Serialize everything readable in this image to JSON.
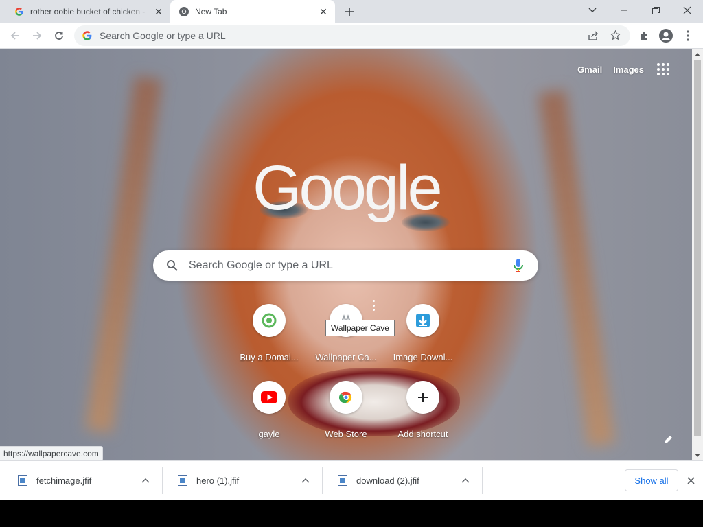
{
  "tabs": [
    {
      "title": "rother oobie bucket of chicken -",
      "active": false
    },
    {
      "title": "New Tab",
      "active": true
    }
  ],
  "omnibox": {
    "placeholder": "Search Google or type a URL"
  },
  "ntp": {
    "top_links": {
      "gmail": "Gmail",
      "images": "Images"
    },
    "logo": "Google",
    "search_placeholder": "Search Google or type a URL",
    "shortcuts": [
      {
        "label": "Buy a Domai...",
        "icon": "green-ring-icon"
      },
      {
        "label": "Wallpaper Ca...",
        "icon": "wallpaper-cave-icon"
      },
      {
        "label": "Image Downl...",
        "icon": "download-arrow-icon"
      },
      {
        "label": "gayle",
        "icon": "youtube-icon"
      },
      {
        "label": "Web Store",
        "icon": "chrome-icon"
      },
      {
        "label": "Add shortcut",
        "icon": "plus-icon"
      }
    ],
    "tooltip": "Wallpaper Cave"
  },
  "status_url": "https://wallpapercave.com",
  "downloads": [
    {
      "name": "fetchimage.jfif"
    },
    {
      "name": "hero (1).jfif"
    },
    {
      "name": "download (2).jfif"
    }
  ],
  "shelf": {
    "show_all": "Show all"
  },
  "colors": {
    "accent": "#1a73e8",
    "tabstrip": "#dee1e6",
    "omnibox": "#f1f3f4"
  }
}
